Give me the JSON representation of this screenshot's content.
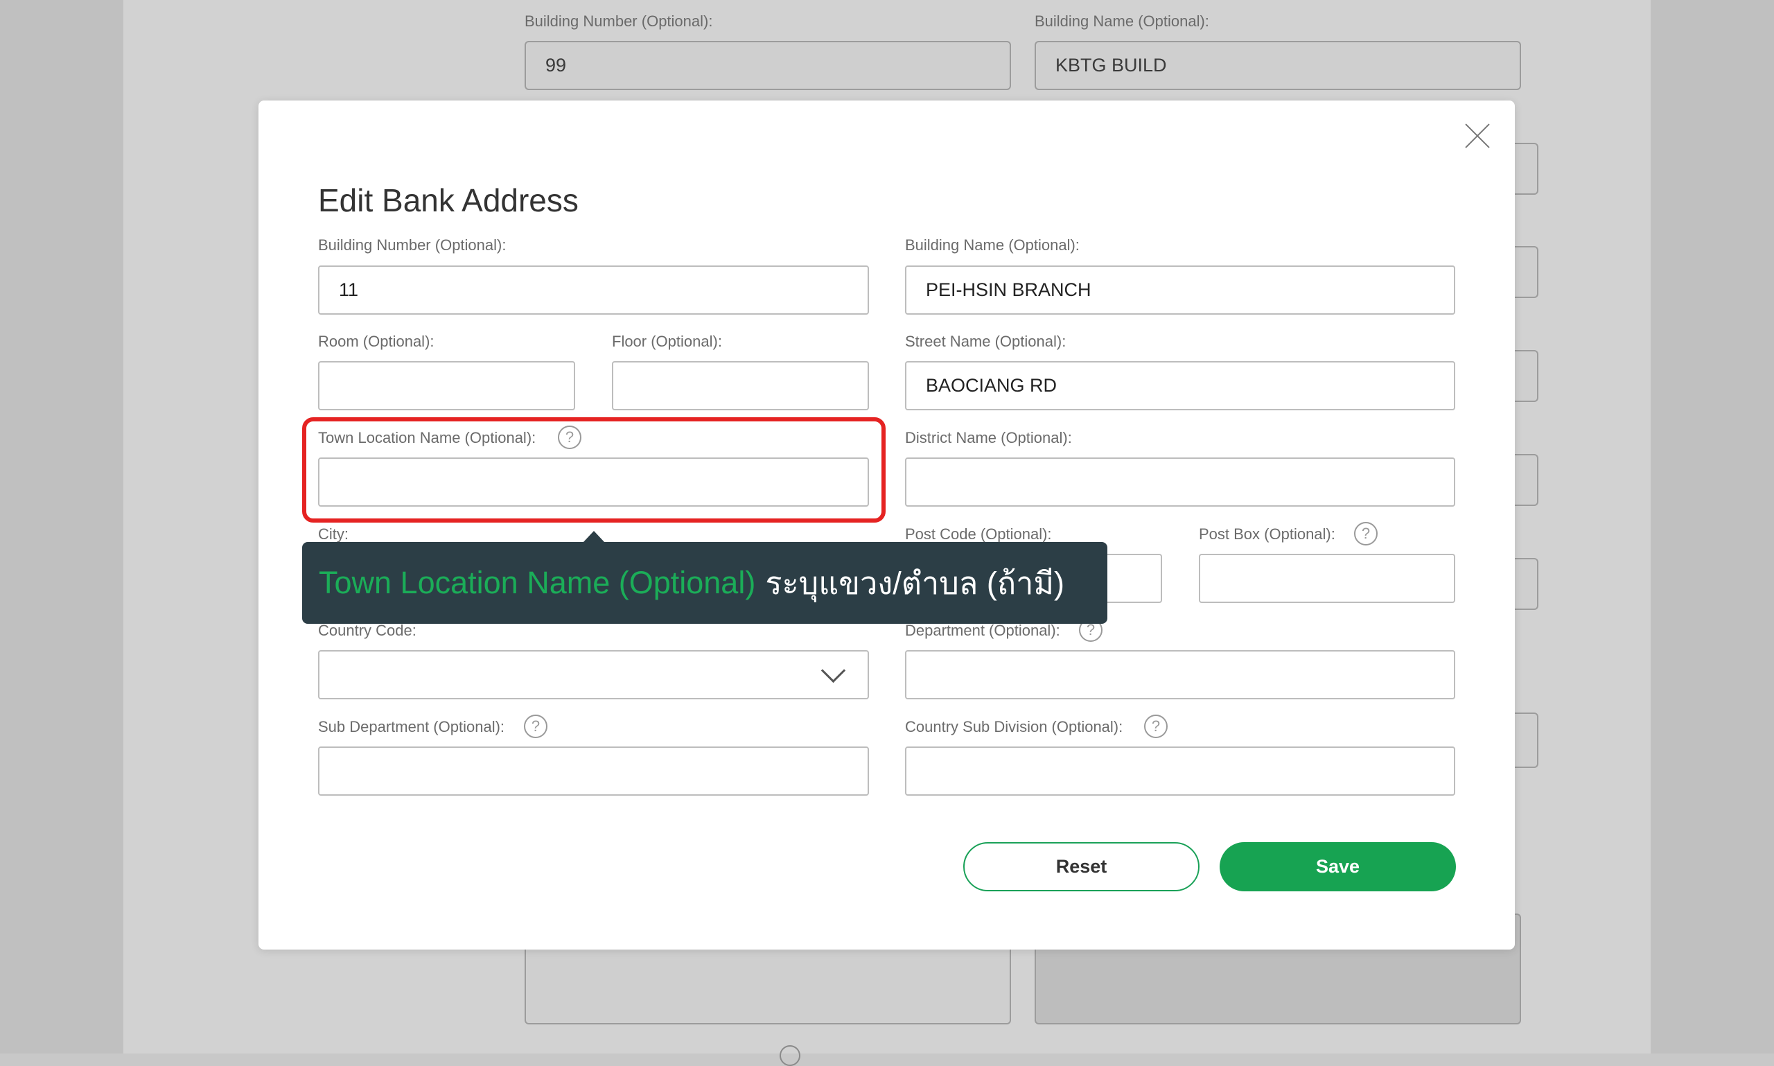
{
  "background_form": {
    "building_number_label": "Building Number (Optional):",
    "building_number_value": "99",
    "building_name_label": "Building Name (Optional):",
    "building_name_value": "KBTG BUILD"
  },
  "modal": {
    "title": "Edit Bank Address",
    "fields": {
      "building_number": {
        "label": "Building Number (Optional):",
        "value": "11"
      },
      "building_name": {
        "label": "Building Name (Optional):",
        "value": "PEI-HSIN BRANCH"
      },
      "room": {
        "label": "Room (Optional):",
        "value": ""
      },
      "floor": {
        "label": "Floor (Optional):",
        "value": ""
      },
      "street_name": {
        "label": "Street Name (Optional):",
        "value": "BAOCIANG RD"
      },
      "town_location_name": {
        "label": "Town Location Name (Optional):",
        "value": ""
      },
      "district_name": {
        "label": "District Name (Optional):",
        "value": ""
      },
      "city": {
        "label": "City:",
        "value": ""
      },
      "post_code": {
        "label": "Post Code (Optional):",
        "value": ""
      },
      "post_box": {
        "label": "Post Box (Optional):",
        "value": ""
      },
      "country_code": {
        "label": "Country Code:",
        "value": ""
      },
      "department": {
        "label": "Department (Optional):",
        "value": ""
      },
      "sub_department": {
        "label": "Sub Department (Optional):",
        "value": ""
      },
      "country_sub_division": {
        "label": "Country Sub Division (Optional):",
        "value": ""
      }
    },
    "help_glyph": "?",
    "buttons": {
      "reset": "Reset",
      "save": "Save"
    }
  },
  "tooltip": {
    "field_name": "Town Location Name (Optional)",
    "description": "ระบุแขวง/ตำบล (ถ้ามี)"
  },
  "colors": {
    "accent_green": "#17a352",
    "highlight_red": "#e52322",
    "tooltip_bg": "#2c3e46"
  }
}
